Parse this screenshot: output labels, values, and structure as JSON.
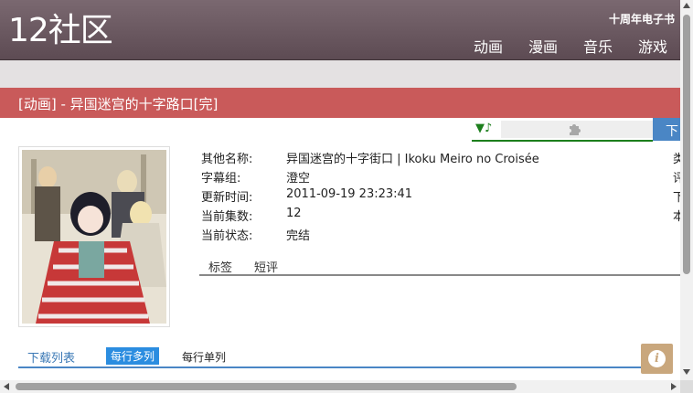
{
  "header": {
    "logo": "12社区",
    "promo": "十周年电子书",
    "nav": [
      "动画",
      "漫画",
      "音乐",
      "游戏"
    ]
  },
  "title": "[动画] - 异国迷宫的十字路口[完]",
  "player": {
    "note_icon": "music-note-icon",
    "plugin_icon": "puzzle-piece-icon",
    "download_label": "下"
  },
  "info": {
    "rows": [
      {
        "key": "其他名称:",
        "value": "异国迷宫的十字街口 | Ikoku Meiro no Croisée"
      },
      {
        "key": "字幕组:",
        "value": "澄空"
      },
      {
        "key": "更新时间:",
        "value": "2011-09-19 23:23:41"
      },
      {
        "key": "当前集数:",
        "value": "12"
      },
      {
        "key": "当前状态:",
        "value": "完结"
      }
    ],
    "right_column": [
      "类",
      "评",
      "下",
      "本"
    ]
  },
  "tabs": [
    "标签",
    "短评"
  ],
  "download": {
    "label": "下载列表",
    "active_tab": "每行多列",
    "alt_tab": "每行单列"
  },
  "colors": {
    "header": "#6b5860",
    "titlebar": "#c95a5a",
    "accent_blue": "#2b8de0",
    "player_green": "#1d7f1d",
    "info_button": "#c9a77d"
  }
}
